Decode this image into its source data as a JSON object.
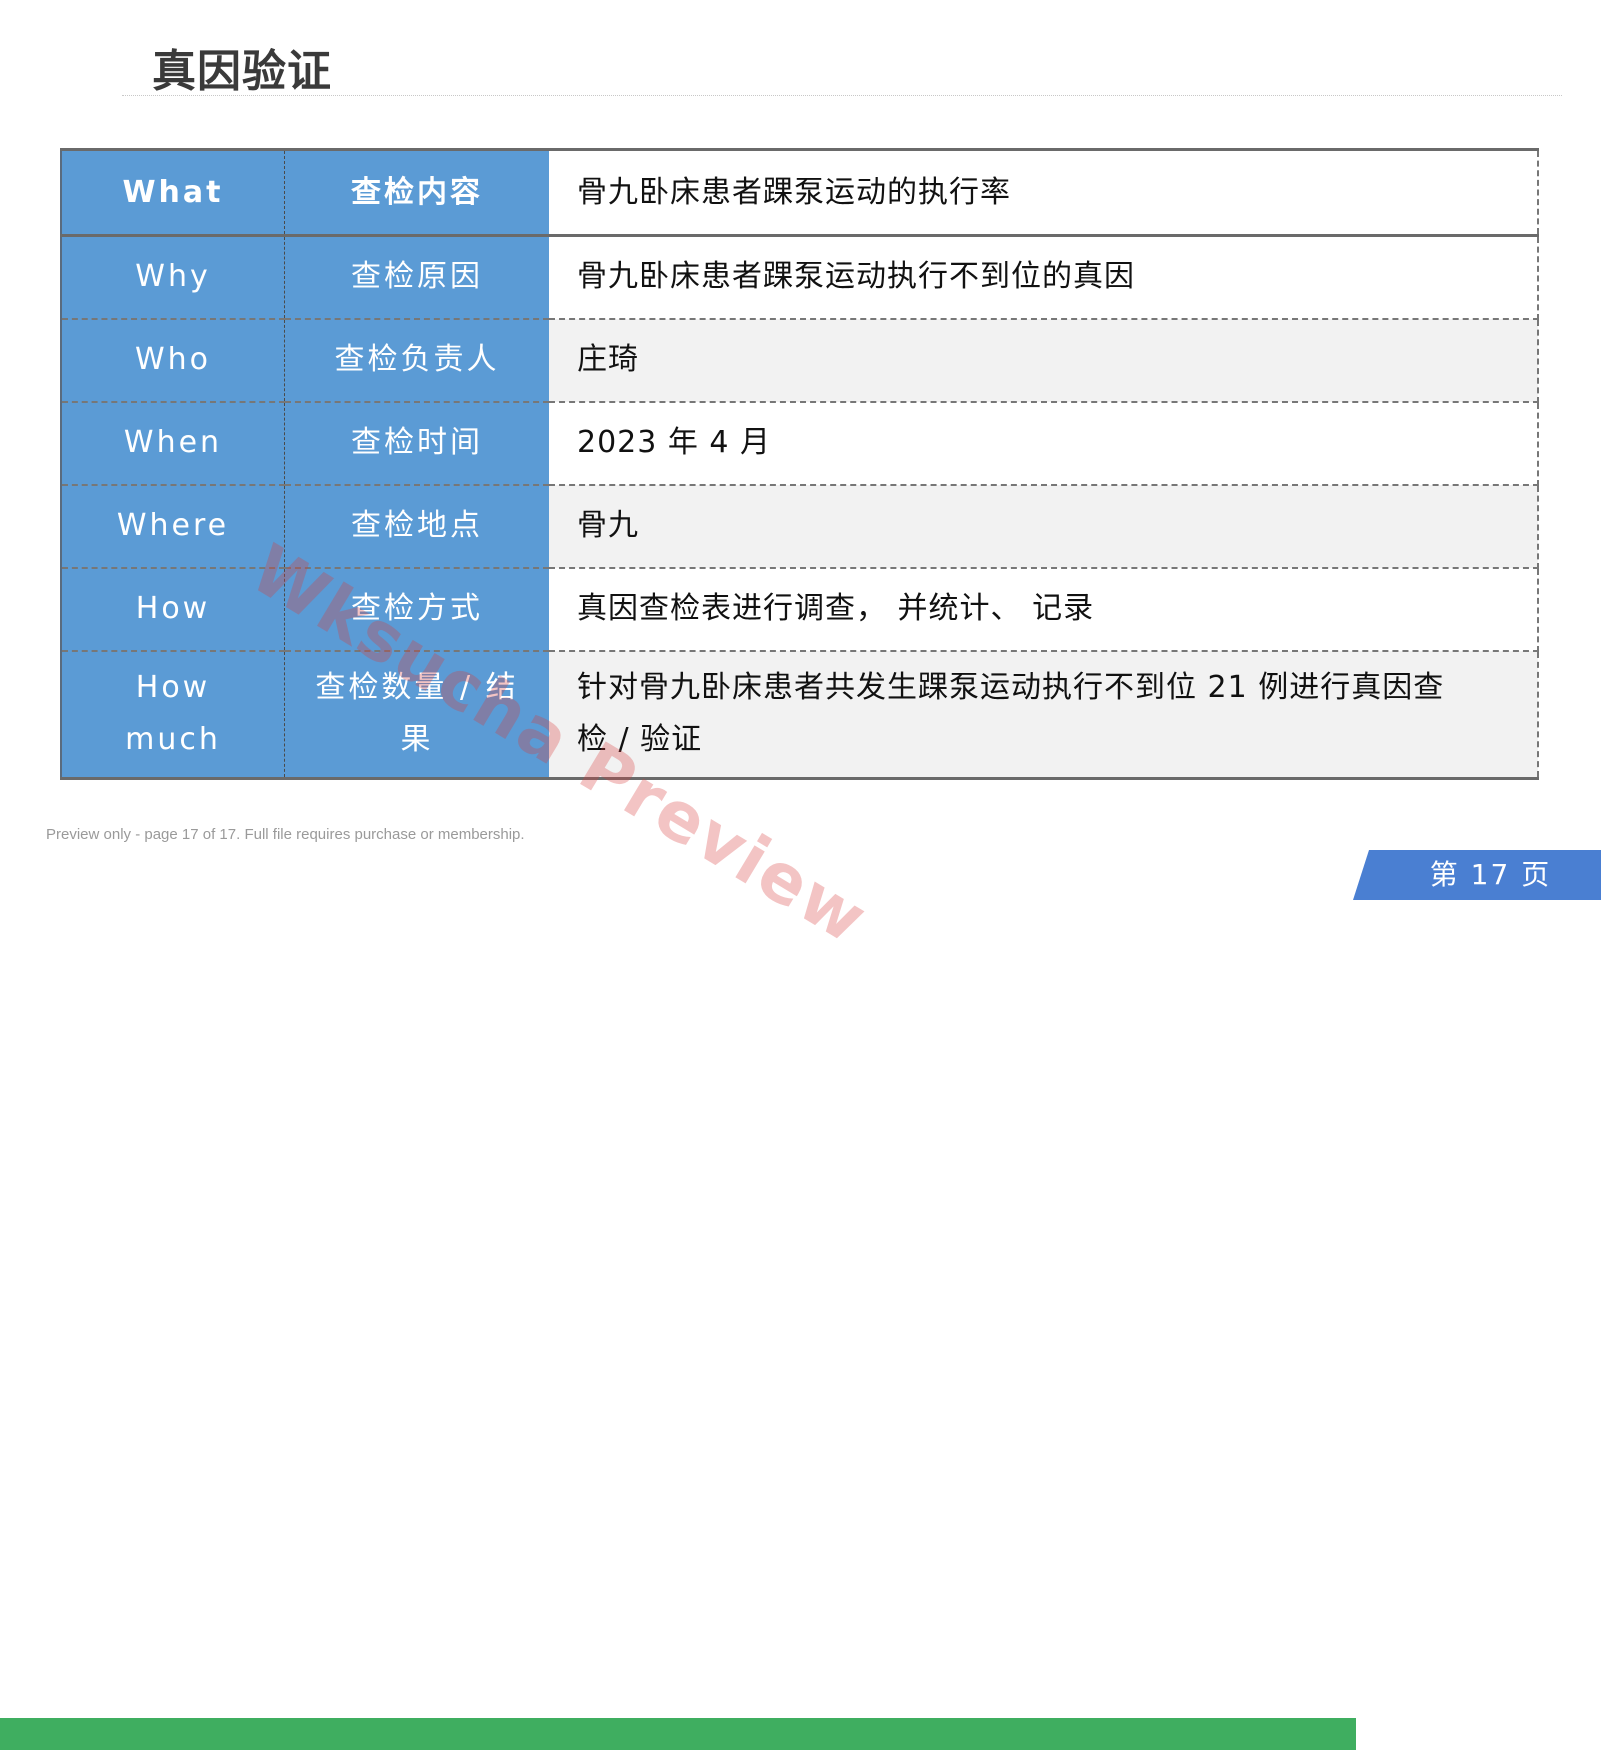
{
  "page": {
    "title": "真因验证",
    "page_label": "第 17 页",
    "notice": "Preview only - page 17 of 17. Full file requires purchase or membership."
  },
  "watermark": "Wksucha Preview",
  "table": {
    "rows": [
      {
        "key": "What",
        "category": "查检内容",
        "value": "骨九卧床患者踝泵运动的执行率"
      },
      {
        "key": "Why",
        "category": "查检原因",
        "value": "骨九卧床患者踝泵运动执行不到位的真因"
      },
      {
        "key": "Who",
        "category": "查检负责人",
        "value": "庄琦"
      },
      {
        "key": "When",
        "category": "查检时间",
        "value": "2023 年 4 月"
      },
      {
        "key": "Where",
        "category": "查检地点",
        "value": "骨九"
      },
      {
        "key": "How",
        "category": "查检方式",
        "value": "真因查检表进行调查， 并统计、 记录"
      },
      {
        "key": "How much",
        "category": "查检数量 / 结果",
        "value": "针对骨九卧床患者共发生踝泵运动执行不到位 21 例进行真因查检 / 验证"
      }
    ]
  },
  "colors": {
    "header_blue": "#5b9bd5",
    "footer_green": "#3fae60",
    "footer_blue": "#4a7fd2",
    "alt_row": "#f2f2f2"
  }
}
